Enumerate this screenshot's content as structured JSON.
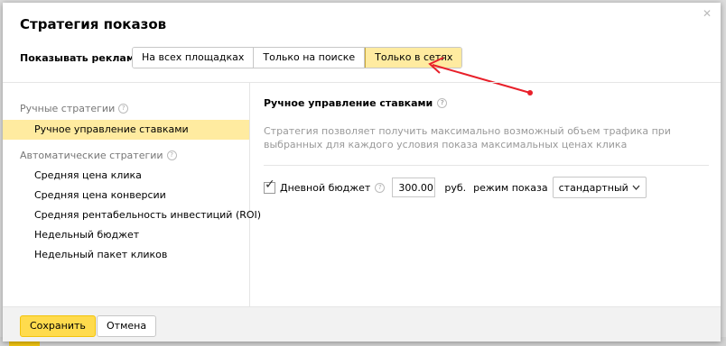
{
  "dialog": {
    "title": "Стратегия показов",
    "close_icon": "close-icon"
  },
  "show_ads": {
    "label": "Показывать рекламу:",
    "options": [
      "На всех площадках",
      "Только на поиске",
      "Только в сетях"
    ],
    "selected": "Только в сетях"
  },
  "annotation": {
    "color": "#e8202a"
  },
  "sidebar": {
    "manual_group": "Ручные стратегии",
    "manual_items": [
      "Ручное управление ставками"
    ],
    "auto_group": "Автоматические стратегии",
    "auto_items": [
      "Средняя цена клика",
      "Средняя цена конверсии",
      "Средняя рентабельность инвестиций (ROI)",
      "Недельный бюджет",
      "Недельный пакет кликов"
    ],
    "selected": "Ручное управление ставками"
  },
  "content": {
    "title": "Ручное управление ставками",
    "description": "Стратегия позволяет получить максимально возможный объем трафика при выбранных для каждого условия показа максимальных ценах клика",
    "daily_budget": {
      "checked": true,
      "label": "Дневной бюджет",
      "value": "300.00",
      "currency": "руб.",
      "mode_label": "режим показа",
      "mode_value": "стандартный"
    }
  },
  "footer": {
    "save": "Сохранить",
    "cancel": "Отмена"
  },
  "colors": {
    "accent": "#ffdb4d",
    "selected_bg": "#ffeba0"
  }
}
